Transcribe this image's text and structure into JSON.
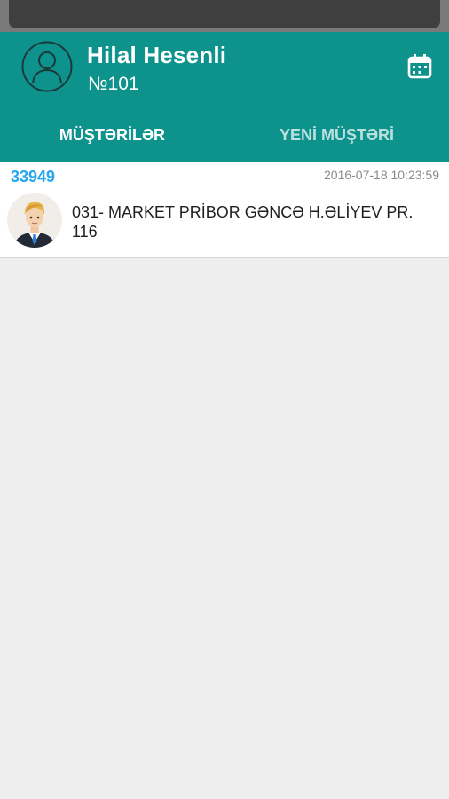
{
  "header": {
    "user_name": "Hilal Hesenli",
    "user_number": "№101",
    "avatar_icon": "user-outline-icon",
    "calendar_icon": "calendar-icon",
    "background_color": "#0e938c"
  },
  "tabs": [
    {
      "label": "MÜŞTƏRİLƏR",
      "active": true
    },
    {
      "label": "YENİ MÜŞTƏRİ",
      "active": false
    }
  ],
  "customers": [
    {
      "id": "33949",
      "datetime": "2016-07-18 10:23:59",
      "name": "031- MARKET PRİBOR GƏNCƏ H.ƏLİYEV PR. 116",
      "avatar_icon": "businessman-avatar-icon"
    }
  ],
  "colors": {
    "id_color": "#29a6ee",
    "list_background": "#eeeeee"
  }
}
